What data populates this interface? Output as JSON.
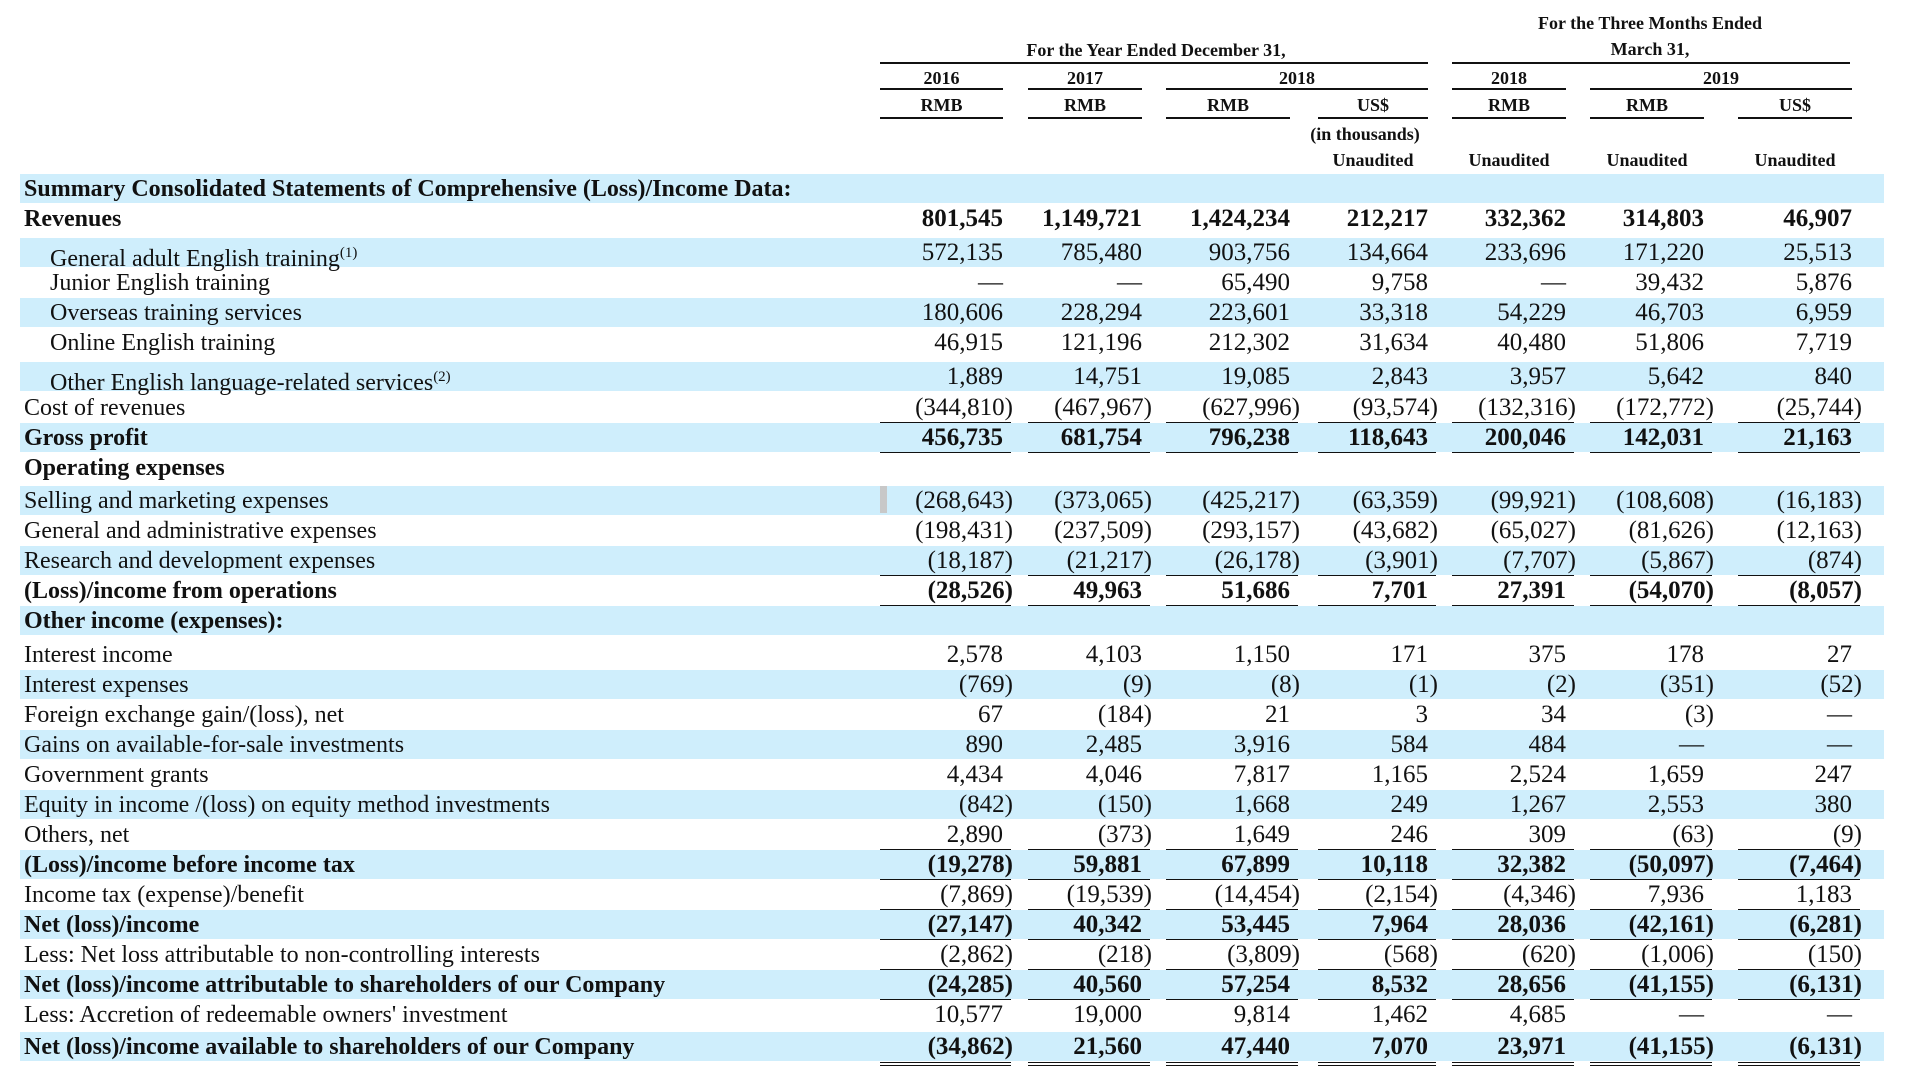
{
  "header": {
    "year_group_title": "For the Year Ended December 31,",
    "quarter_group_title_line1": "For the Three Months Ended",
    "quarter_group_title_line2": "March 31,",
    "year_2018_span": "2018",
    "year_2019_span": "2019",
    "in_thousands": "(in thousands)",
    "columns": [
      {
        "year": "2016",
        "currency": "RMB",
        "note": ""
      },
      {
        "year": "2017",
        "currency": "RMB",
        "note": ""
      },
      {
        "year": "",
        "currency": "RMB",
        "note": ""
      },
      {
        "year": "",
        "currency": "US$",
        "note": "Unaudited"
      },
      {
        "year": "2018",
        "currency": "RMB",
        "note": "Unaudited"
      },
      {
        "year": "",
        "currency": "RMB",
        "note": "Unaudited"
      },
      {
        "year": "",
        "currency": "US$",
        "note": "Unaudited"
      }
    ]
  },
  "rows": [
    {
      "label": "Summary Consolidated Statements of Comprehensive (Loss)/Income Data:",
      "bold": true,
      "values": [
        "",
        "",
        "",
        "",
        "",
        "",
        ""
      ]
    },
    {
      "label": "Revenues",
      "bold": true,
      "values": [
        "801,545",
        "1,149,721",
        "1,424,234",
        "212,217",
        "332,362",
        "314,803",
        "46,907"
      ]
    },
    {
      "label": "General adult English training",
      "sup": "(1)",
      "indent": true,
      "values": [
        "572,135",
        "785,480",
        "903,756",
        "134,664",
        "233,696",
        "171,220",
        "25,513"
      ]
    },
    {
      "label": "Junior English training",
      "indent": true,
      "values": [
        "—",
        "—",
        "65,490",
        "9,758",
        "—",
        "39,432",
        "5,876"
      ]
    },
    {
      "label": "Overseas training services",
      "indent": true,
      "values": [
        "180,606",
        "228,294",
        "223,601",
        "33,318",
        "54,229",
        "46,703",
        "6,959"
      ]
    },
    {
      "label": "Online English training",
      "indent": true,
      "values": [
        "46,915",
        "121,196",
        "212,302",
        "31,634",
        "40,480",
        "51,806",
        "7,719"
      ]
    },
    {
      "label": "Other English language-related services",
      "sup": "(2)",
      "indent": true,
      "values": [
        "1,889",
        "14,751",
        "19,085",
        "2,843",
        "3,957",
        "5,642",
        "840"
      ]
    },
    {
      "label": "Cost of revenues",
      "values": [
        "(344,810)",
        "(467,967)",
        "(627,996)",
        "(93,574)",
        "(132,316)",
        "(172,772)",
        "(25,744)"
      ]
    },
    {
      "label": "Gross profit",
      "bold": true,
      "values": [
        "456,735",
        "681,754",
        "796,238",
        "118,643",
        "200,046",
        "142,031",
        "21,163"
      ]
    },
    {
      "label": "Operating expenses",
      "bold": true,
      "values": [
        "",
        "",
        "",
        "",
        "",
        "",
        ""
      ]
    },
    {
      "label": "Selling and marketing expenses",
      "values": [
        "(268,643)",
        "(373,065)",
        "(425,217)",
        "(63,359)",
        "(99,921)",
        "(108,608)",
        "(16,183)"
      ]
    },
    {
      "label": "General and administrative expenses",
      "values": [
        "(198,431)",
        "(237,509)",
        "(293,157)",
        "(43,682)",
        "(65,027)",
        "(81,626)",
        "(12,163)"
      ]
    },
    {
      "label": "Research and development expenses",
      "values": [
        "(18,187)",
        "(21,217)",
        "(26,178)",
        "(3,901)",
        "(7,707)",
        "(5,867)",
        "(874)"
      ]
    },
    {
      "label": "(Loss)/income from operations",
      "bold": true,
      "values": [
        "(28,526)",
        "49,963",
        "51,686",
        "7,701",
        "27,391",
        "(54,070)",
        "(8,057)"
      ]
    },
    {
      "label": "Other income (expenses):",
      "bold": true,
      "values": [
        "",
        "",
        "",
        "",
        "",
        "",
        ""
      ]
    },
    {
      "label": "Interest income",
      "values": [
        "2,578",
        "4,103",
        "1,150",
        "171",
        "375",
        "178",
        "27"
      ]
    },
    {
      "label": "Interest expenses",
      "values": [
        "(769)",
        "(9)",
        "(8)",
        "(1)",
        "(2)",
        "(351)",
        "(52)"
      ]
    },
    {
      "label": "Foreign exchange gain/(loss), net",
      "values": [
        "67",
        "(184)",
        "21",
        "3",
        "34",
        "(3)",
        "—"
      ]
    },
    {
      "label": "Gains on available-for-sale investments",
      "values": [
        "890",
        "2,485",
        "3,916",
        "584",
        "484",
        "—",
        "—"
      ]
    },
    {
      "label": "Government grants",
      "values": [
        "4,434",
        "4,046",
        "7,817",
        "1,165",
        "2,524",
        "1,659",
        "247"
      ]
    },
    {
      "label": "Equity in income /(loss) on equity method investments",
      "values": [
        "(842)",
        "(150)",
        "1,668",
        "249",
        "1,267",
        "2,553",
        "380"
      ]
    },
    {
      "label": "Others, net",
      "values": [
        "2,890",
        "(373)",
        "1,649",
        "246",
        "309",
        "(63)",
        "(9)"
      ]
    },
    {
      "label": "(Loss)/income before income tax",
      "bold": true,
      "values": [
        "(19,278)",
        "59,881",
        "67,899",
        "10,118",
        "32,382",
        "(50,097)",
        "(7,464)"
      ]
    },
    {
      "label": "Income tax (expense)/benefit",
      "values": [
        "(7,869)",
        "(19,539)",
        "(14,454)",
        "(2,154)",
        "(4,346)",
        "7,936",
        "1,183"
      ]
    },
    {
      "label": "Net (loss)/income",
      "bold": true,
      "values": [
        "(27,147)",
        "40,342",
        "53,445",
        "7,964",
        "28,036",
        "(42,161)",
        "(6,281)"
      ]
    },
    {
      "label": "Less: Net loss attributable to non-controlling interests",
      "values": [
        "(2,862)",
        "(218)",
        "(3,809)",
        "(568)",
        "(620)",
        "(1,006)",
        "(150)"
      ]
    },
    {
      "label": "Net (loss)/income attributable to shareholders of our Company",
      "bold": true,
      "values": [
        "(24,285)",
        "40,560",
        "57,254",
        "8,532",
        "28,656",
        "(41,155)",
        "(6,131)"
      ]
    },
    {
      "label": "Less: Accretion of redeemable owners' investment",
      "values": [
        "10,577",
        "19,000",
        "9,814",
        "1,462",
        "4,685",
        "—",
        "—"
      ]
    },
    {
      "label": "Net (loss)/income available to shareholders of our Company",
      "bold": true,
      "values": [
        "(34,862)",
        "21,560",
        "47,440",
        "7,070",
        "23,971",
        "(41,155)",
        "(6,131)"
      ]
    }
  ]
}
